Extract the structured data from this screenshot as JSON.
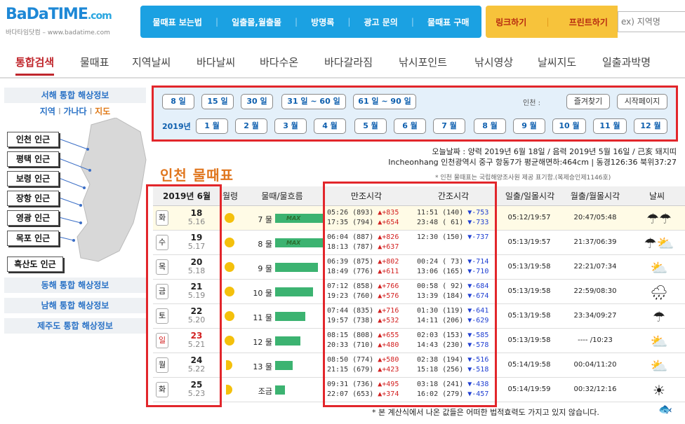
{
  "header": {
    "logo_line1": "BaDa",
    "logo_line2": "TIME",
    "logo_line3": ".com",
    "logo_sub": "바다타임닷컴 – www.badatime.com",
    "topnav": [
      "물때표 보는법",
      "일출몰,월출몰",
      "방명록",
      "광고 문의",
      "물때표 구매"
    ],
    "actions": [
      "링크하기",
      "프린트하기"
    ],
    "search_placeholder": "ex) 지역명"
  },
  "mainnav": [
    "통합검색",
    "물때표",
    "지역날씨",
    "바다날씨",
    "바다수온",
    "바다갈라짐",
    "낚시포인트",
    "낚시영상",
    "날씨지도",
    "일출과박명"
  ],
  "sidebar": {
    "title": "서해 통합 해상정보",
    "links": [
      "지역",
      "가나다",
      "지도"
    ],
    "regions": [
      "인천 인근",
      "평택 인근",
      "보령 인근",
      "장항 인근",
      "영광 인근",
      "목포 인근",
      "흑산도 인근"
    ],
    "buttons": [
      "동해 통합 해상정보",
      "남해 통합 해상정보",
      "제주도 통합 해상정보"
    ]
  },
  "period": {
    "ranges": [
      "8 일",
      "15 일",
      "30 일",
      "31 일 ~ 60 일",
      "61 일 ~ 90 일"
    ],
    "location_label": "인천 :",
    "favorite": "즐겨찾기",
    "homepage": "시작페이지",
    "year": "2019년",
    "months": [
      "1 월",
      "2 월",
      "3 월",
      "4 월",
      "5 월",
      "6 월",
      "7 월",
      "8 월",
      "9 월",
      "10 월",
      "11 월",
      "12 월"
    ]
  },
  "info": {
    "date_line": "오늘날짜 : 양력 2019년 6월 18일 / 음력 2019년 5월 16일 / 己亥 돼지띠",
    "location_line": "Incheonhang 인천광역시 중구 항동7가 평균해면하:464cm | 동경126:36 북위37:27",
    "title": "인천 물때표",
    "note": "* 인천 물때표는 국립해양조사원 제공 표기함.(복제승인제1146호)"
  },
  "table": {
    "headers": [
      "2019년 6월",
      "월령",
      "물때/물흐름",
      "만조시각",
      "간조시각",
      "일출/일몰시각",
      "월출/월몰시각",
      "날씨"
    ],
    "max_label": "MAX",
    "rows": [
      {
        "dow": "화",
        "day": "18",
        "lunar": "5.16",
        "moon": "full",
        "tide": "7 물",
        "flow": 0.95,
        "max": true,
        "high1": "05:26 (893) ",
        "hc1": "▲+835",
        "high2": "17:35 (794) ",
        "hc2": "▲+654",
        "low1": "11:51 (140) ",
        "lc1": "▼-753",
        "low2": "23:48 ( 61) ",
        "lc2": "▼-733",
        "sun": "05:12/19:57",
        "moontime": "20:47/05:48",
        "weather": "☂☂"
      },
      {
        "dow": "수",
        "day": "19",
        "lunar": "5.17",
        "moon": "full",
        "tide": "8 물",
        "flow": 0.95,
        "max": true,
        "high1": "06:04 (887) ",
        "hc1": "▲+826",
        "high2": "18:13 (787) ",
        "hc2": "▲+637",
        "low1": "12:30 (150) ",
        "lc1": "▼-737",
        "low2": "",
        "lc2": "",
        "sun": "05:13/19:57",
        "moontime": "21:37/06:39",
        "weather": "☂⛅"
      },
      {
        "dow": "목",
        "day": "20",
        "lunar": "5.18",
        "moon": "full",
        "tide": "9 물",
        "flow": 0.85,
        "max": false,
        "high1": "06:39 (875) ",
        "hc1": "▲+802",
        "high2": "18:49 (776) ",
        "hc2": "▲+611",
        "low1": "00:24 ( 73) ",
        "lc1": "▼-714",
        "low2": "13:06 (165) ",
        "lc2": "▼-710",
        "sun": "05:13/19:58",
        "moontime": "22:21/07:34",
        "weather": "⛅"
      },
      {
        "dow": "금",
        "day": "21",
        "lunar": "5.19",
        "moon": "full",
        "tide": "10 물",
        "flow": 0.75,
        "max": false,
        "high1": "07:12 (858) ",
        "hc1": "▲+766",
        "high2": "19:23 (760) ",
        "hc2": "▲+576",
        "low1": "00:58 ( 92) ",
        "lc1": "▼-684",
        "low2": "13:39 (184) ",
        "lc2": "▼-674",
        "sun": "05:13/19:58",
        "moontime": "22:59/08:30",
        "weather": "🌧"
      },
      {
        "dow": "토",
        "day": "22",
        "lunar": "5.20",
        "moon": "full",
        "tide": "11 물",
        "flow": 0.6,
        "max": false,
        "high1": "07:44 (835) ",
        "hc1": "▲+716",
        "high2": "19:57 (738) ",
        "hc2": "▲+532",
        "low1": "01:30 (119) ",
        "lc1": "▼-641",
        "low2": "14:11 (206) ",
        "lc2": "▼-629",
        "sun": "05:13/19:58",
        "moontime": "23:34/09:27",
        "weather": "☂"
      },
      {
        "dow": "일",
        "day": "23",
        "lunar": "5.21",
        "moon": "full",
        "tide": "12 물",
        "flow": 0.5,
        "max": false,
        "high1": "08:15 (808) ",
        "hc1": "▲+655",
        "high2": "20:33 (710) ",
        "hc2": "▲+480",
        "low1": "02:03 (153) ",
        "lc1": "▼-585",
        "low2": "14:43 (230) ",
        "lc2": "▼-578",
        "sun": "05:13/19:58",
        "moontime": "---- /10:23",
        "weather": "⛅"
      },
      {
        "dow": "월",
        "day": "24",
        "lunar": "5.22",
        "moon": "half",
        "tide": "13 물",
        "flow": 0.35,
        "max": false,
        "high1": "08:50 (774) ",
        "hc1": "▲+580",
        "high2": "21:15 (679) ",
        "hc2": "▲+423",
        "low1": "02:38 (194) ",
        "lc1": "▼-516",
        "low2": "15:18 (256) ",
        "lc2": "▼-518",
        "sun": "05:14/19:58",
        "moontime": "00:04/11:20",
        "weather": "⛅"
      },
      {
        "dow": "화",
        "day": "25",
        "lunar": "5.23",
        "moon": "half",
        "tide": "조금",
        "flow": 0.2,
        "max": false,
        "high1": "09:31 (736) ",
        "hc1": "▲+495",
        "high2": "22:07 (653) ",
        "hc2": "▲+374",
        "low1": "03:18 (241) ",
        "lc1": "▼-438",
        "low2": "16:02 (279) ",
        "lc2": "▼-457",
        "sun": "05:14/19:59",
        "moontime": "00:32/12:16",
        "weather": "☀"
      }
    ]
  },
  "footnote": "* 본 계산식에서 나온 값들은 어떠한 법적효력도 가지고 있지 않습니다.",
  "colors": {
    "accent": "#1ba1e2",
    "highlight": "#e2262b",
    "title": "#e0761e",
    "bar": "#3cb371"
  }
}
